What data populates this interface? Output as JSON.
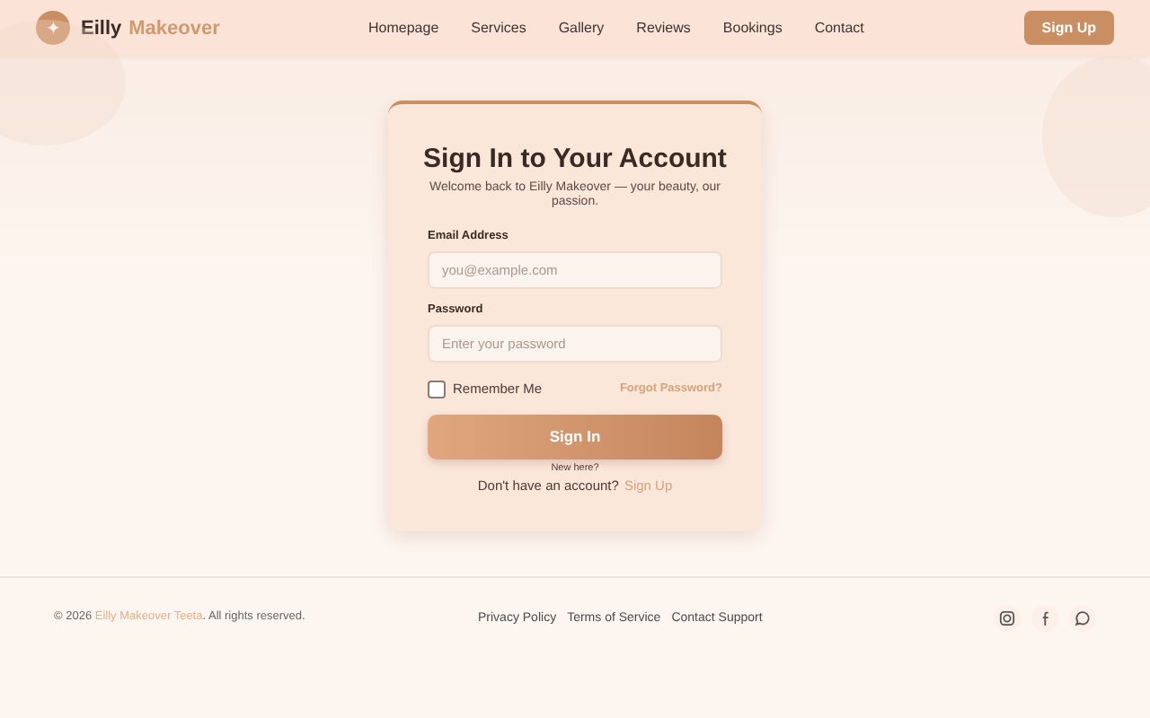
{
  "header": {
    "brand_first": "Eilly",
    "brand_second": "Makeover",
    "logo_glyph": "✦",
    "nav": [
      {
        "label": "Homepage"
      },
      {
        "label": "Services"
      },
      {
        "label": "Gallery"
      },
      {
        "label": "Reviews"
      },
      {
        "label": "Bookings"
      },
      {
        "label": "Contact"
      }
    ],
    "signup_button": "Sign Up"
  },
  "card": {
    "title": "Sign In to Your Account",
    "subtitle": "Welcome back to Eilly Makeover — your beauty, our passion.",
    "fields": [
      {
        "label": "Email Address",
        "placeholder": "you@example.com"
      },
      {
        "label": "Password",
        "placeholder": "Enter your password"
      }
    ],
    "remember": {
      "label": "Remember Me",
      "checked": false
    },
    "forgot_link": "Forgot Password?",
    "submit": "Sign In",
    "new_here": "New here?",
    "no_account": "Don't have an account?",
    "signup_link": "Sign Up"
  },
  "footer": {
    "copyright_prefix": "© 2026",
    "copyright_link": "Eilly Makeover Teeta",
    "copyright_suffix": ". All rights reserved.",
    "links": [
      "Privacy Policy",
      "Terms of Service",
      "Contact Support"
    ],
    "social": [
      {
        "kind": "instagram"
      },
      {
        "kind": "facebook"
      },
      {
        "kind": "chat"
      }
    ]
  }
}
